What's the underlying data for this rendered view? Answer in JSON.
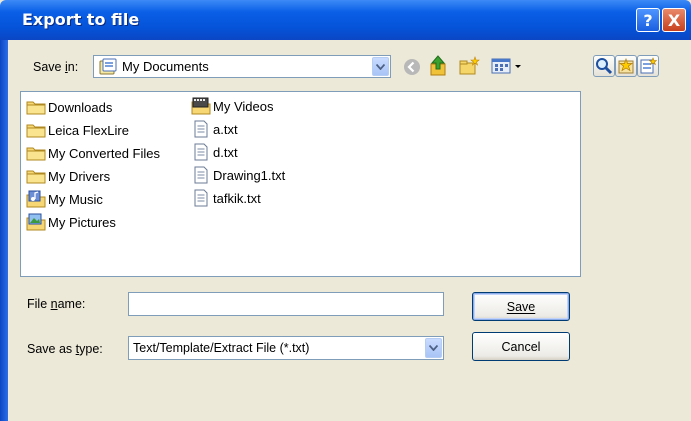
{
  "dialog": {
    "title": "Export to file",
    "help_glyph": "?",
    "close_glyph": "X"
  },
  "save_in": {
    "label": "Save in:",
    "value": "My Documents"
  },
  "files": {
    "col1": [
      {
        "name": "Downloads",
        "icon": "folder-icon"
      },
      {
        "name": "Leica FlexLire",
        "icon": "folder-icon"
      },
      {
        "name": "My Converted Files",
        "icon": "folder-icon"
      },
      {
        "name": "My Drivers",
        "icon": "folder-icon"
      },
      {
        "name": "My Music",
        "icon": "music-folder-icon"
      },
      {
        "name": "My Pictures",
        "icon": "pictures-folder-icon"
      }
    ],
    "col2": [
      {
        "name": "My Videos",
        "icon": "video-folder-icon"
      },
      {
        "name": "a.txt",
        "icon": "text-file-icon"
      },
      {
        "name": "d.txt",
        "icon": "text-file-icon"
      },
      {
        "name": "Drawing1.txt",
        "icon": "text-file-icon"
      },
      {
        "name": "tafkik.txt",
        "icon": "text-file-icon"
      }
    ]
  },
  "file_name": {
    "label": "File name:",
    "value": ""
  },
  "save_as_type": {
    "label": "Save as type:",
    "value": "Text/Template/Extract File (*.txt)"
  },
  "buttons": {
    "save": "Save",
    "cancel": "Cancel"
  }
}
